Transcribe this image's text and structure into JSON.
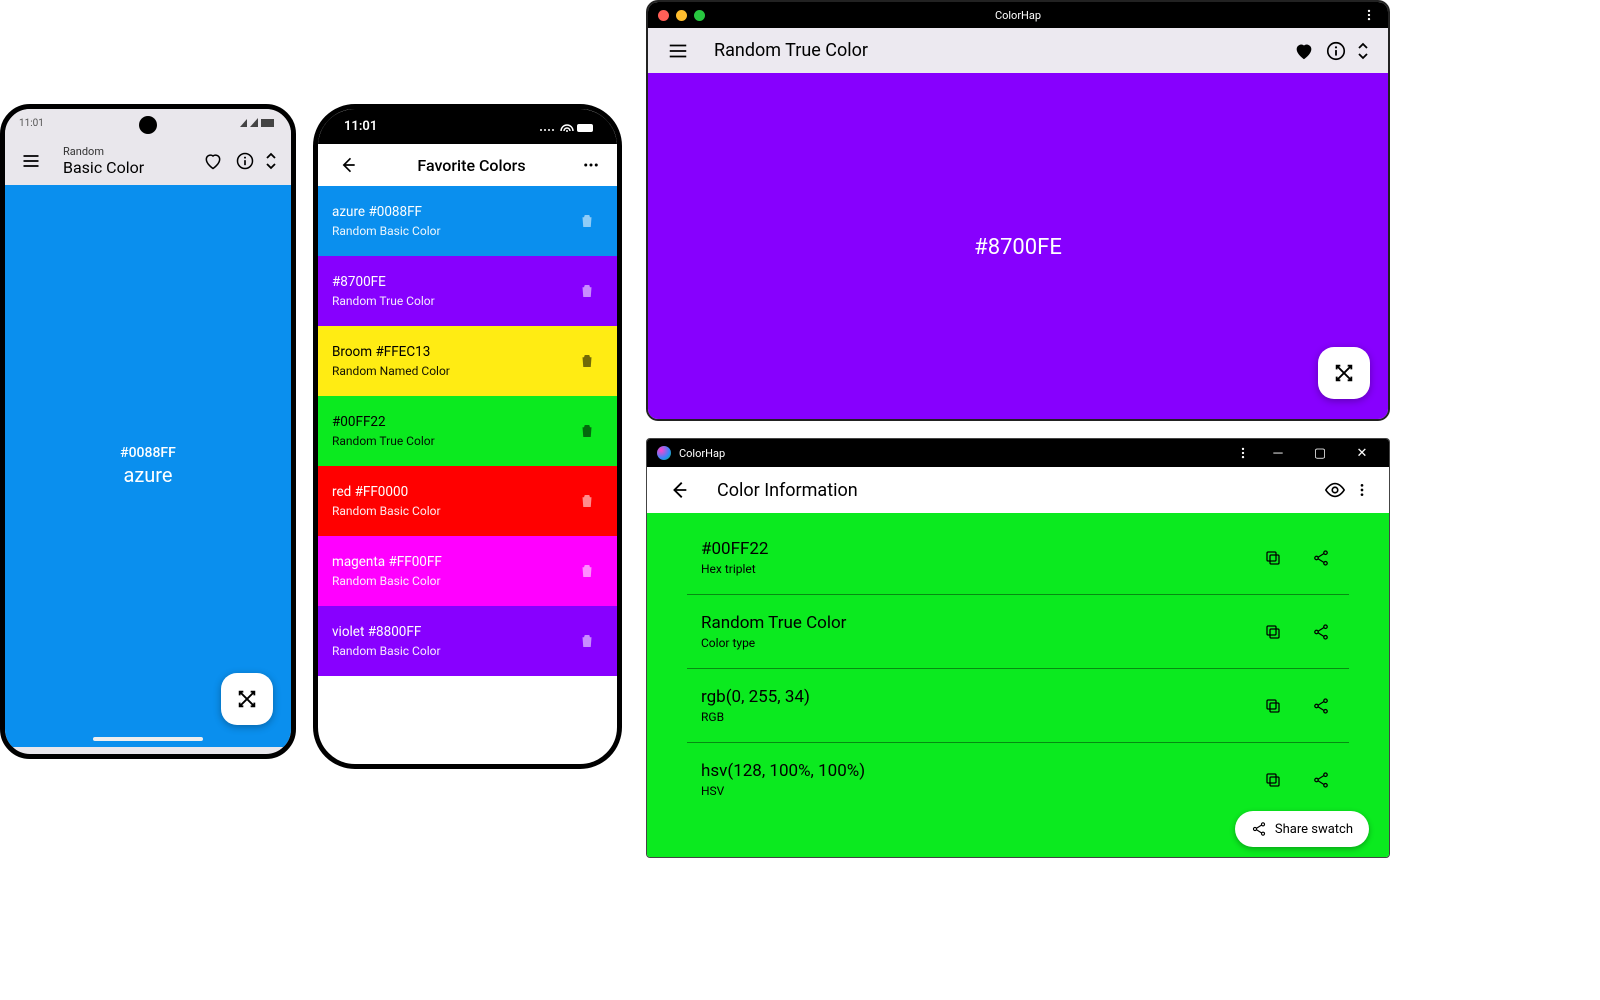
{
  "phone1": {
    "time": "11:01",
    "sub": "Random",
    "title": "Basic Color",
    "hex": "#0088FF",
    "name": "azure",
    "swatch_color": "#0a8fee"
  },
  "phone2": {
    "time": "11:01",
    "title": "Favorite Colors",
    "items": [
      {
        "title": "azure #0088FF",
        "sub": "Random Basic Color",
        "bg": "#0a8fee",
        "fg": "#fff"
      },
      {
        "title": "#8700FE",
        "sub": "Random True Color",
        "bg": "#8700fe",
        "fg": "#fff"
      },
      {
        "title": "Broom #FFEC13",
        "sub": "Random Named Color",
        "bg": "#ffec13",
        "fg": "#000"
      },
      {
        "title": "#00FF22",
        "sub": "Random True Color",
        "bg": "#0bea1f",
        "fg": "#000"
      },
      {
        "title": "red #FF0000",
        "sub": "Random Basic Color",
        "bg": "#ff0000",
        "fg": "#fff"
      },
      {
        "title": "magenta #FF00FF",
        "sub": "Random Basic Color",
        "bg": "#ff00ff",
        "fg": "#fff"
      },
      {
        "title": "violet #8800FF",
        "sub": "Random Basic Color",
        "bg": "#8800ff",
        "fg": "#fff"
      }
    ]
  },
  "mac": {
    "window_title": "ColorHap",
    "title": "Random True Color",
    "hex": "#8700FE",
    "swatch_color": "#8700fe"
  },
  "win": {
    "window_title": "ColorHap",
    "title": "Color Information",
    "swatch_color": "#0bea1f",
    "rows": [
      {
        "value": "#00FF22",
        "label": "Hex triplet"
      },
      {
        "value": "Random True Color",
        "label": "Color type"
      },
      {
        "value": "rgb(0, 255, 34)",
        "label": "RGB"
      },
      {
        "value": "hsv(128, 100%, 100%)",
        "label": "HSV"
      }
    ],
    "share_label": "Share swatch"
  }
}
